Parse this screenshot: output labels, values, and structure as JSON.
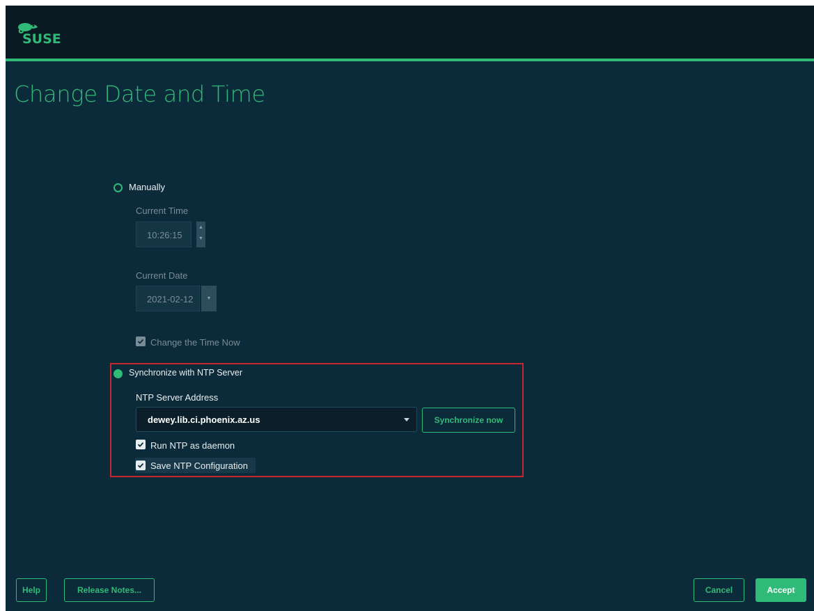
{
  "brand": {
    "logo_text": "SUSE",
    "accent": "#30ba78",
    "background": "#0c2b3a"
  },
  "page": {
    "title": "Change Date and Time"
  },
  "manual": {
    "radio_label": "Manually",
    "current_time_label": "Current Time",
    "current_time_value": "10:26:15",
    "current_date_label": "Current Date",
    "current_date_value": "2021-02-12",
    "change_now_label": "Change the Time Now"
  },
  "ntp": {
    "radio_label": "Synchronize with NTP Server",
    "server_address_label": "NTP Server Address",
    "server_address_value": "dewey.lib.ci.phoenix.az.us",
    "sync_button": "Synchronize now",
    "run_daemon_label": "Run NTP as daemon",
    "save_config_label": "Save NTP Configuration"
  },
  "footer": {
    "help": "Help",
    "release_notes": "Release Notes...",
    "cancel": "Cancel",
    "accept": "Accept"
  },
  "icons": [
    "suse-chameleon-logo-icon",
    "spin-up-icon",
    "spin-down-icon",
    "dropdown-arrow-icon",
    "checkmark-icon"
  ]
}
